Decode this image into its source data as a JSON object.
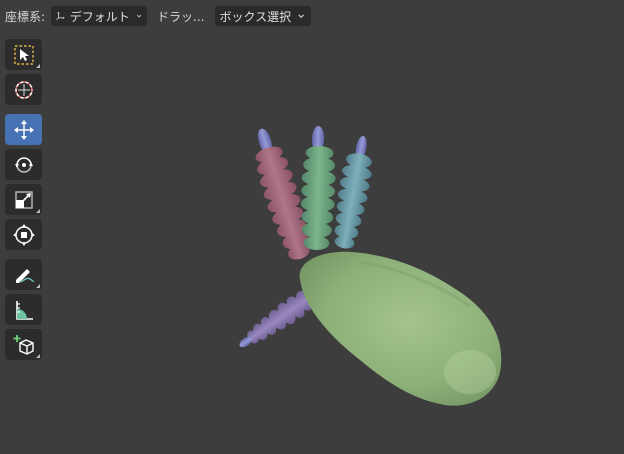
{
  "header": {
    "orientation_label": "座標系:",
    "orientation_value": "デフォルト",
    "drag_label": "ドラッ...",
    "drag_value": "ボックス選択"
  },
  "toolbar": {
    "tools": [
      {
        "name": "select-box",
        "active": false
      },
      {
        "name": "cursor",
        "active": false
      },
      {
        "name": "move",
        "active": true
      },
      {
        "name": "rotate",
        "active": false
      },
      {
        "name": "scale",
        "active": false
      },
      {
        "name": "transform",
        "active": false
      },
      {
        "name": "annotate",
        "active": false
      },
      {
        "name": "measure",
        "active": false
      },
      {
        "name": "add-cube",
        "active": false
      }
    ]
  },
  "colors": {
    "viewport_bg": "#3d3d3d",
    "active_tool": "#4772b3",
    "body_green": "#8fb27a",
    "finger_pink": "#a4687a",
    "finger_green": "#6fa47f",
    "finger_teal": "#6a9ca6",
    "finger_purple": "#8a79ae",
    "tip_blue": "#7f85c4"
  }
}
